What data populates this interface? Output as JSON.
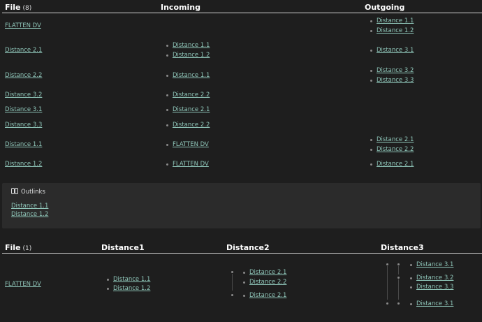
{
  "table1": {
    "headers": {
      "file": "File",
      "file_count": "(8)",
      "incoming": "Incoming",
      "outgoing": "Outgoing"
    },
    "rows": [
      {
        "file": "FLATTEN DV",
        "incoming": [],
        "outgoing": [
          "Distance 1.1",
          "Distance 1.2"
        ]
      },
      {
        "file": "Distance 2.1",
        "incoming": [
          "Distance 1.1",
          "Distance 1.2"
        ],
        "outgoing": [
          "Distance 3.1"
        ]
      },
      {
        "file": "Distance 2.2",
        "incoming": [
          "Distance 1.1"
        ],
        "outgoing": [
          "Distance 3.2",
          "Distance 3.3"
        ]
      },
      {
        "file": "Distance 3.2",
        "incoming": [
          "Distance 2.2"
        ],
        "outgoing": []
      },
      {
        "file": "Distance 3.1",
        "incoming": [
          "Distance 2.1"
        ],
        "outgoing": []
      },
      {
        "file": "Distance 3.3",
        "incoming": [
          "Distance 2.2"
        ],
        "outgoing": []
      },
      {
        "file": "Distance 1.1",
        "incoming": [
          "FLATTEN DV"
        ],
        "outgoing": [
          "Distance 2.1",
          "Distance 2.2"
        ]
      },
      {
        "file": "Distance 1.2",
        "incoming": [
          "FLATTEN DV"
        ],
        "outgoing": [
          "Distance 2.1"
        ]
      }
    ]
  },
  "callout": {
    "icon": "link-icon",
    "title": "Outlinks",
    "links": [
      "Distance 1.1",
      "Distance 1.2"
    ]
  },
  "table2": {
    "headers": {
      "file": "File",
      "file_count": "(1)",
      "distance1": "Distance1",
      "distance2": "Distance2",
      "distance3": "Distance3"
    },
    "row": {
      "file": "FLATTEN DV",
      "distance1": [
        "Distance 1.1",
        "Distance 1.2"
      ],
      "distance2_groups": [
        [
          "Distance 2.1",
          "Distance 2.2"
        ],
        [
          "Distance 2.1"
        ]
      ],
      "distance3_groups": [
        [
          [
            "Distance 3.1"
          ],
          [
            "Distance 3.2",
            "Distance 3.3"
          ]
        ],
        [
          [
            "Distance 3.1"
          ]
        ]
      ]
    }
  }
}
